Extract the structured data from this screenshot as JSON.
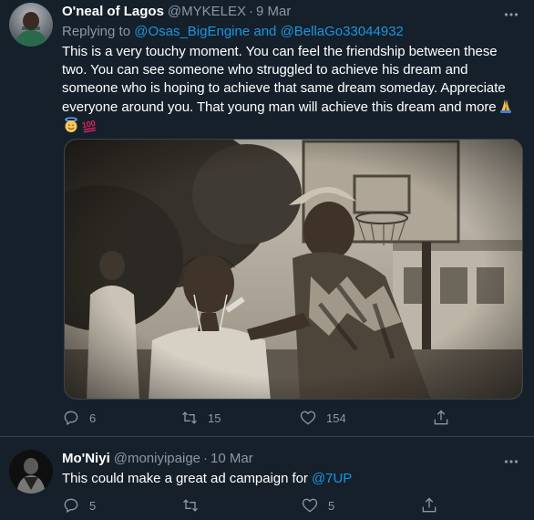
{
  "tweets": [
    {
      "display_name": "O'neal of Lagos",
      "handle": "@MYKELEX",
      "separator": "·",
      "date": "9 Mar",
      "replying_prefix": "Replying to",
      "reply_mention_1": "@Osas_BigEngine",
      "reply_and": "and",
      "reply_mention_2": "@BellaGo33044932",
      "text": "This is a very touchy moment. You can feel the friendship between these two. You can see someone who struggled to achieve his dream and someone who is hoping to achieve that same dream someday. Appreciate everyone around you. That young man will achieve this dream and more",
      "emojis": [
        "folded-hands-icon",
        "smiling-face-with-halo-icon",
        "hundred-points-icon"
      ],
      "actions": {
        "replies": "6",
        "retweets": "15",
        "likes": "154"
      }
    },
    {
      "display_name": "Mo'Niyi",
      "handle": "@moniyipaige",
      "separator": "·",
      "date": "10 Mar",
      "text": "This could make a great ad campaign for",
      "mention": "@7UP",
      "actions": {
        "replies": "5",
        "retweets": "",
        "likes": "5"
      }
    }
  ],
  "colors": {
    "background": "#15202b",
    "primary_text": "#ffffff",
    "secondary_text": "#8899a6",
    "link": "#1b95e0",
    "divider": "#38444d"
  }
}
